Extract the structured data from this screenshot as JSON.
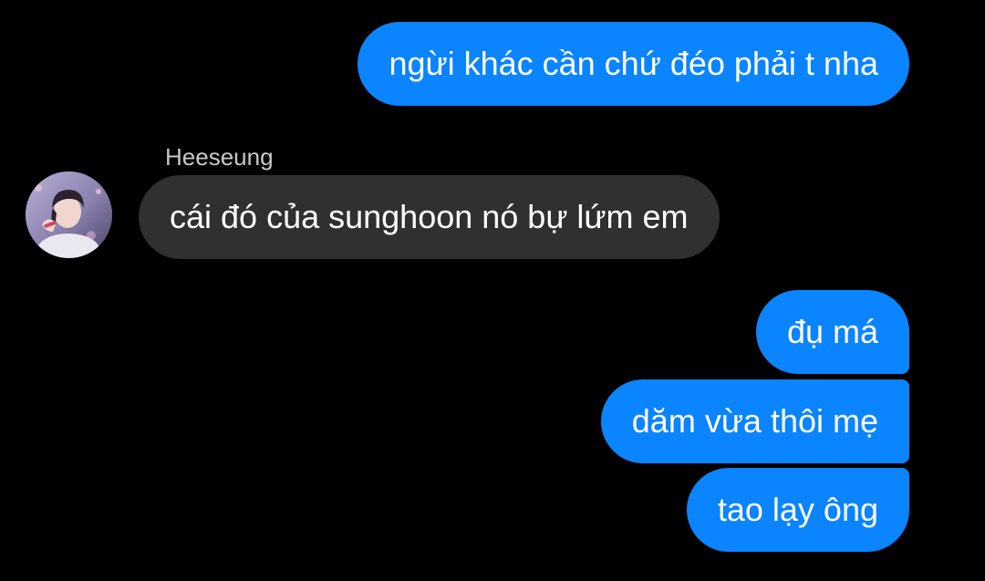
{
  "conversation": {
    "messages": [
      {
        "direction": "outgoing",
        "text": "ngừi khác cần chứ đéo phải t nha"
      },
      {
        "direction": "incoming",
        "sender": "Heeseung",
        "text": "cái đó của sunghoon nó bự lứm em"
      },
      {
        "direction": "outgoing",
        "text": "đụ má"
      },
      {
        "direction": "outgoing",
        "text": "dăm vừa thôi mẹ"
      },
      {
        "direction": "outgoing",
        "text": "tao lạy ông"
      }
    ]
  },
  "colors": {
    "background": "#000000",
    "outgoing_bubble": "#0a84ff",
    "incoming_bubble": "#303030",
    "sender_name": "#c8c8c8"
  },
  "icons": {
    "avatar": "profile-photo"
  }
}
